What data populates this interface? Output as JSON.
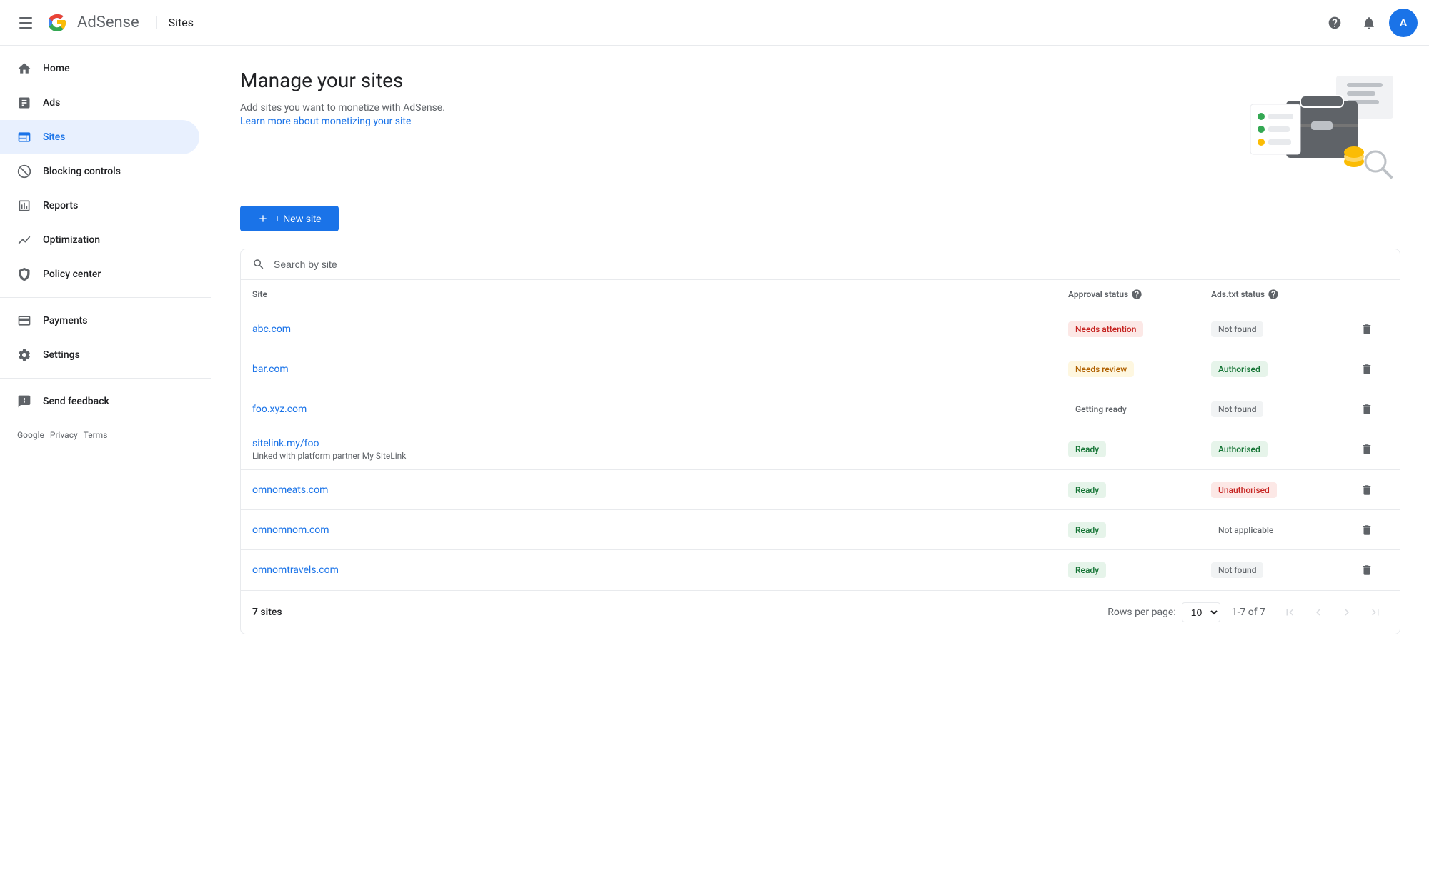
{
  "topnav": {
    "app_name": "AdSense",
    "page_title": "Sites",
    "avatar_letter": "A"
  },
  "sidebar": {
    "items": [
      {
        "id": "home",
        "label": "Home",
        "icon": "home"
      },
      {
        "id": "ads",
        "label": "Ads",
        "icon": "ads"
      },
      {
        "id": "sites",
        "label": "Sites",
        "icon": "sites",
        "active": true
      },
      {
        "id": "blocking-controls",
        "label": "Blocking controls",
        "icon": "blocking"
      },
      {
        "id": "reports",
        "label": "Reports",
        "icon": "reports"
      },
      {
        "id": "optimization",
        "label": "Optimization",
        "icon": "optimization"
      },
      {
        "id": "policy-center",
        "label": "Policy center",
        "icon": "policy"
      },
      {
        "id": "payments",
        "label": "Payments",
        "icon": "payments"
      },
      {
        "id": "settings",
        "label": "Settings",
        "icon": "settings"
      },
      {
        "id": "send-feedback",
        "label": "Send feedback",
        "icon": "feedback"
      }
    ],
    "footer": {
      "brand": "Google",
      "privacy": "Privacy",
      "terms": "Terms"
    }
  },
  "main": {
    "title": "Manage your sites",
    "subtitle": "Add sites you want to monetize with AdSense.",
    "learn_more_text": "Learn more about monetizing your site",
    "learn_more_url": "#",
    "new_site_label": "+ New site",
    "search_placeholder": "Search by site",
    "table": {
      "columns": [
        {
          "id": "site",
          "label": "Site"
        },
        {
          "id": "approval_status",
          "label": "Approval status"
        },
        {
          "id": "ads_txt_status",
          "label": "Ads.txt status"
        }
      ],
      "rows": [
        {
          "site": "abc.com",
          "sub": "",
          "approval_status": "Needs attention",
          "approval_badge": "needs-attention",
          "ads_txt": "Not found",
          "ads_txt_badge": "not-found"
        },
        {
          "site": "bar.com",
          "sub": "",
          "approval_status": "Needs review",
          "approval_badge": "needs-review",
          "ads_txt": "Authorised",
          "ads_txt_badge": "authorised"
        },
        {
          "site": "foo.xyz.com",
          "sub": "",
          "approval_status": "Getting ready",
          "approval_badge": "getting-ready",
          "ads_txt": "Not found",
          "ads_txt_badge": "not-found"
        },
        {
          "site": "sitelink.my/foo",
          "sub": "Linked with platform partner My SiteLink",
          "approval_status": "Ready",
          "approval_badge": "ready",
          "ads_txt": "Authorised",
          "ads_txt_badge": "authorised"
        },
        {
          "site": "omnomeats.com",
          "sub": "",
          "approval_status": "Ready",
          "approval_badge": "ready",
          "ads_txt": "Unauthorised",
          "ads_txt_badge": "unauthorised"
        },
        {
          "site": "omnomnom.com",
          "sub": "",
          "approval_status": "Ready",
          "approval_badge": "ready",
          "ads_txt": "Not applicable",
          "ads_txt_badge": "not-applicable"
        },
        {
          "site": "omnomtravels.com",
          "sub": "",
          "approval_status": "Ready",
          "approval_badge": "ready",
          "ads_txt": "Not found",
          "ads_txt_badge": "not-found"
        }
      ],
      "footer": {
        "total_sites": "7 sites",
        "rows_per_page_label": "Rows per page:",
        "rows_per_page_value": "10",
        "page_range": "1-7 of 7"
      }
    }
  }
}
